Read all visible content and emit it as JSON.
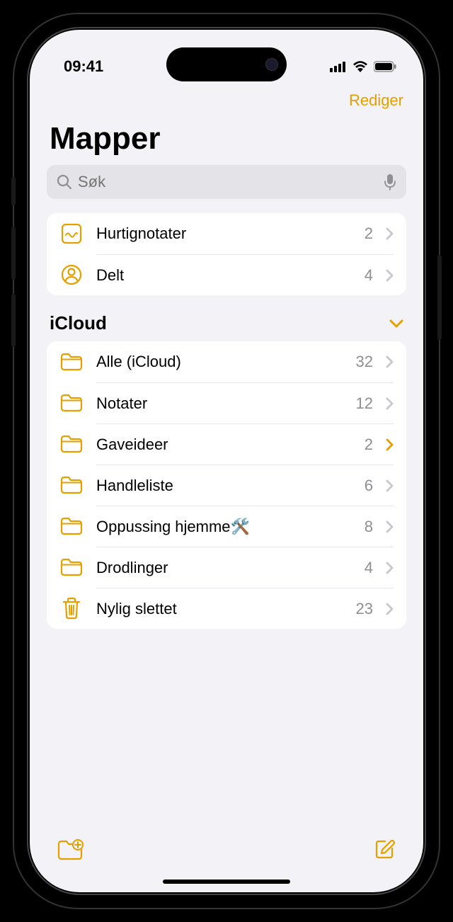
{
  "status": {
    "time": "09:41"
  },
  "nav": {
    "edit": "Rediger"
  },
  "title": "Mapper",
  "search": {
    "placeholder": "Søk"
  },
  "top_list": [
    {
      "icon": "quicknote",
      "label": "Hurtignotater",
      "count": "2"
    },
    {
      "icon": "shared",
      "label": "Delt",
      "count": "4"
    }
  ],
  "section": {
    "title": "iCloud"
  },
  "icloud_list": [
    {
      "icon": "folder",
      "label": "Alle (iCloud)",
      "count": "32",
      "highlighted": false
    },
    {
      "icon": "folder",
      "label": "Notater",
      "count": "12",
      "highlighted": false
    },
    {
      "icon": "folder",
      "label": "Gaveideer",
      "count": "2",
      "highlighted": true
    },
    {
      "icon": "folder",
      "label": "Handleliste",
      "count": "6",
      "highlighted": false
    },
    {
      "icon": "folder",
      "label": "Oppussing hjemme🛠️",
      "count": "8",
      "highlighted": false
    },
    {
      "icon": "folder",
      "label": "Drodlinger",
      "count": "4",
      "highlighted": false
    },
    {
      "icon": "trash",
      "label": "Nylig slettet",
      "count": "23",
      "highlighted": false
    }
  ]
}
